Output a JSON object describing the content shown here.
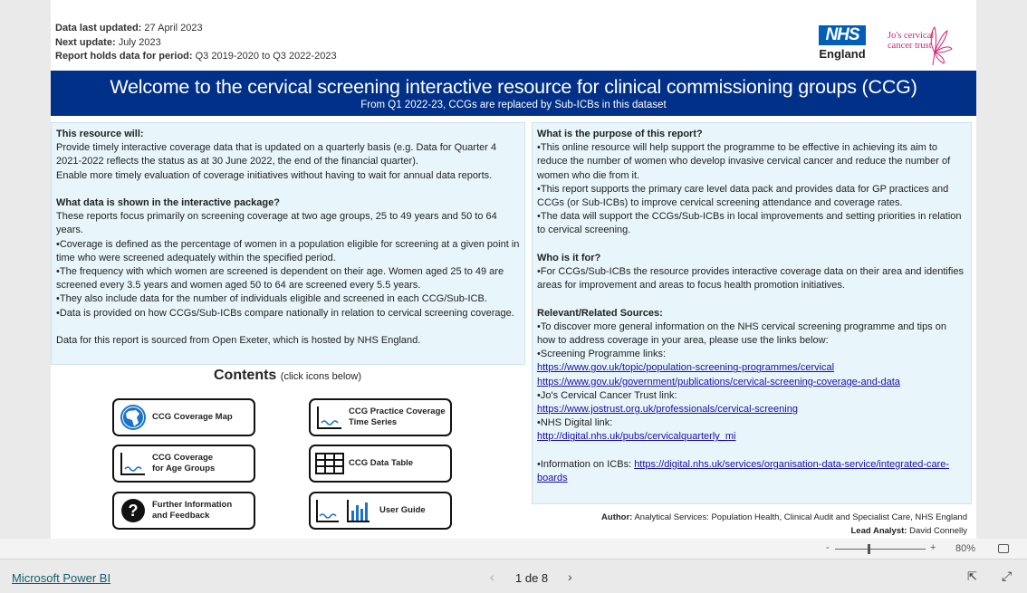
{
  "header": {
    "meta": [
      {
        "label": "Data last updated:",
        "value": "27 April 2023"
      },
      {
        "label": "Next update:",
        "value": "July 2023"
      },
      {
        "label": "Report holds data for period:",
        "value": "Q3 2019-2020 to Q3 2022-2023"
      }
    ],
    "nhs_logo": "NHS",
    "nhs_sub": "England",
    "jos_logo_line1": "Jo's cervical",
    "jos_logo_line2": "cancer trust",
    "title": "Welcome to the cervical screening interactive resource for clinical commissioning groups (CCG)",
    "subtitle": "From Q1 2022-23, CCGs are replaced by Sub-ICBs in this dataset"
  },
  "left_panel": {
    "h1": "This resource will:",
    "p1": "Provide timely interactive coverage data that is updated on a quarterly basis (e.g. Data for Quarter 4 2021-2022 reflects the status as at 30 June 2022, the end of the financial quarter).",
    "p2": "Enable more timely evaluation of coverage initiatives without having to wait for annual data reports.",
    "h2": "What data is shown in the interactive package?",
    "p3": "These reports focus primarily on screening coverage at two age groups, 25 to 49 years and 50 to 64 years.",
    "p4": "•Coverage is defined as the percentage of women in a population eligible for screening at a given point in time who were screened adequately within the specified period.",
    "p5": "•The frequency with which women are screened is dependent on their age. Women aged 25 to 49 are screened every 3.5 years and women aged 50 to 64 are screened every 5.5 years.",
    "p6": "•They also include data for the number of individuals eligible and screened in each CCG/Sub-ICB.",
    "p7": "•Data is provided on how CCGs/Sub-ICBs compare nationally in relation to cervical screening coverage.",
    "p8": "Data for this report is sourced from Open Exeter, which is hosted by NHS England."
  },
  "right_panel": {
    "h1": "What is the purpose of this report?",
    "p1": "•This online resource will help support the programme to be effective in achieving its aim to reduce the number of women who develop invasive cervical cancer and reduce the number of women who die from it.",
    "p2": "•This report supports the primary care level data pack and provides data for GP practices and CCGs (or Sub-ICBs) to improve cervical screening attendance and coverage rates.",
    "p3": "•The data will support the CCGs/Sub-ICBs in local improvements and setting priorities in relation to cervical screening.",
    "h2": "Who is it for?",
    "p4": "•For CCGs/Sub-ICBs the resource provides interactive coverage data on their area and identifies areas for improvement and areas to focus health promotion initiatives.",
    "h3": "Relevant/Related Sources:",
    "p5": "•To discover more general information on the NHS cervical screening programme and tips on how to address coverage in your area, please use the links below:",
    "p6": "•Screening Programme links:",
    "link1": "https://www.gov.uk/topic/population-screening-programmes/cervical",
    "link2": "https://www.gov.uk/government/publications/cervical-screening-coverage-and-data",
    "p7": "•Jo's Cervical Cancer Trust link:",
    "link3": "https://www.jostrust.org.uk/professionals/cervical-screening",
    "p8": "•NHS Digital link:",
    "link4": "http://digital.nhs.uk/pubs/cervicalquarterly_mi",
    "p9": "•Information on ICBs: ",
    "link5": "https://digital.nhs.uk/services/organisation-data-service/integrated-care-boards"
  },
  "contents": {
    "title": "Contents",
    "hint": "(click icons below)",
    "buttons": [
      {
        "line1": "CCG Coverage Map",
        "line2": "",
        "icon": "globe-icon"
      },
      {
        "line1": "CCG Practice Coverage",
        "line2": "Time Series",
        "icon": "line-chart-icon"
      },
      {
        "line1": "CCG Coverage",
        "line2": "for Age Groups",
        "icon": "line-chart-icon"
      },
      {
        "line1": "CCG Data Table",
        "line2": "",
        "icon": "table-icon"
      },
      {
        "line1": "Further Information",
        "line2": "and Feedback",
        "icon": "question-icon"
      },
      {
        "line1": "User Guide",
        "line2": "",
        "icon": "bar-chart-icon"
      }
    ]
  },
  "author": {
    "label": "Author:",
    "value": "Analytical Services: Population Health, Clinical Audit and Specialist Care, NHS England",
    "lead_label": "Lead Analyst:",
    "lead_value": "David Connelly"
  },
  "zoom": {
    "minus": "-",
    "plus": "+",
    "level": "80%",
    "percent": 80
  },
  "footer": {
    "brand": "Microsoft Power BI",
    "page": "1 de 8"
  },
  "colors": {
    "banner": "#003087",
    "nhs_blue": "#005eb8",
    "panel": "#e8f5fa",
    "jos_pink": "#d4237a",
    "icon_blue": "#1a73c8"
  }
}
